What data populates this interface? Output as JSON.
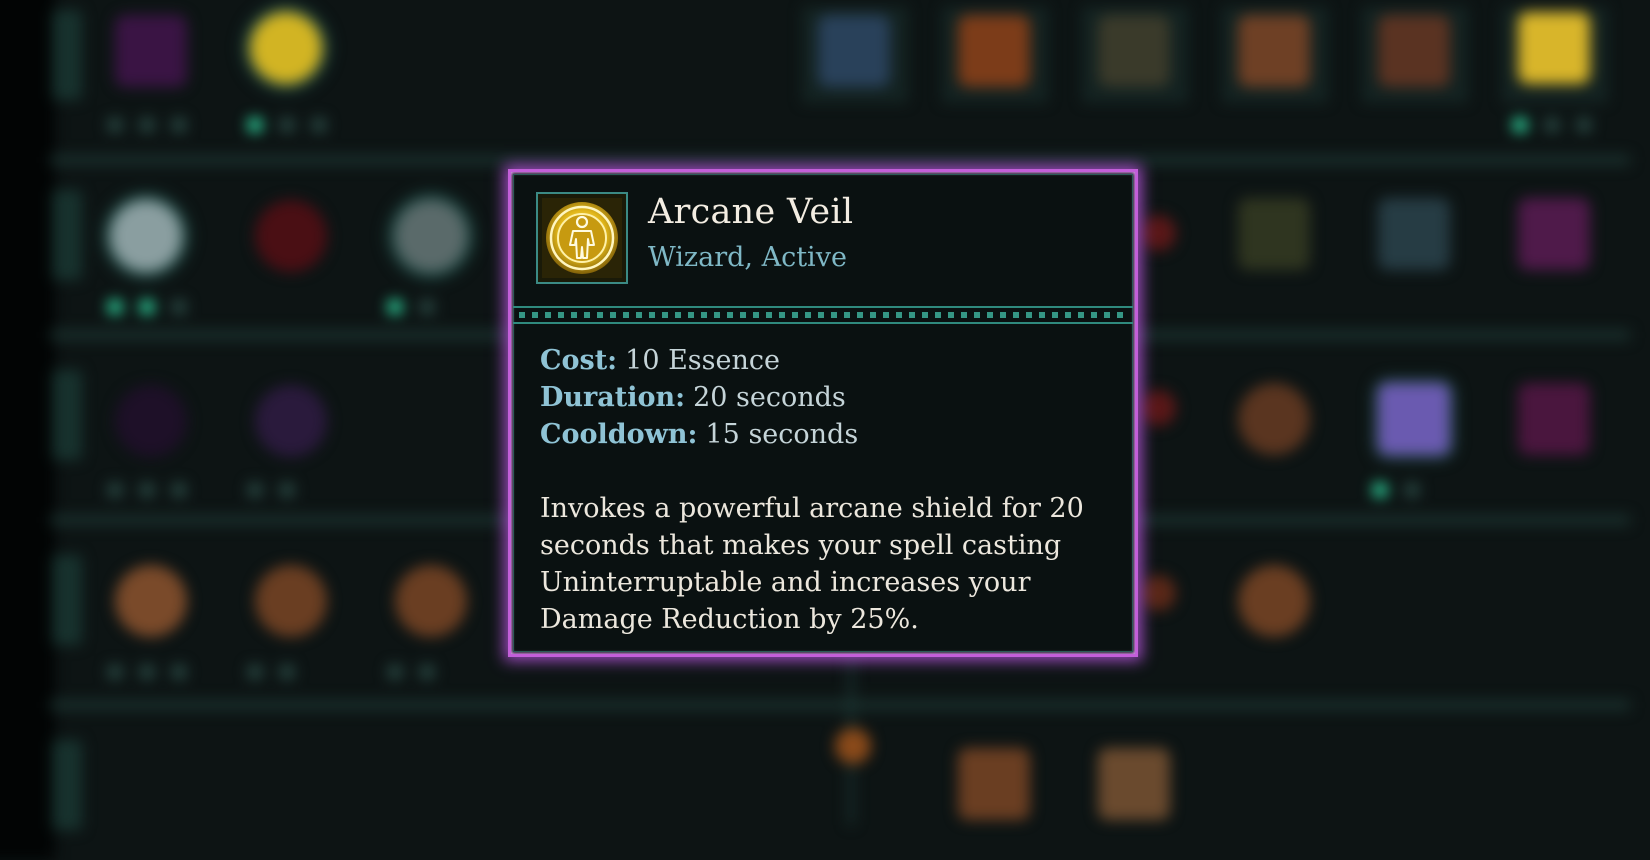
{
  "tooltip": {
    "icon": "golden-arcane-shield-figure-icon",
    "name": "Arcane Veil",
    "type": "Wizard, Active",
    "stats": [
      {
        "label": "Cost:",
        "value": "10 Essence"
      },
      {
        "label": "Duration:",
        "value": "20 seconds"
      },
      {
        "label": "Cooldown:",
        "value": "15 seconds"
      }
    ],
    "description_lines": [
      "Invokes a powerful arcane shield for 20",
      "seconds that makes your spell casting",
      "Uninterruptable and increases your",
      "Damage Reduction by 25%."
    ]
  },
  "colors": {
    "frame_glow": "#c35fd9",
    "title_text": "#f3ede2",
    "subtitle_text": "#7fb8c6",
    "stat_label": "#8fc3d5",
    "background": "#0d1414"
  }
}
